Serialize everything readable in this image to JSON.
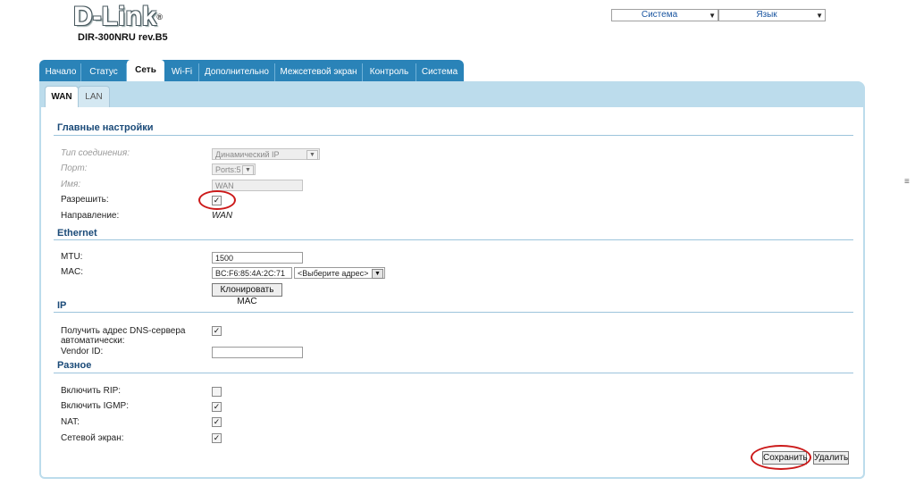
{
  "logo": {
    "brand": "D-Link",
    "reg": "®",
    "model": "DIR-300NRU rev.B5"
  },
  "top_selects": {
    "system": "Система",
    "language": "Язык"
  },
  "tabs": [
    {
      "label": "Начало"
    },
    {
      "label": "Статус"
    },
    {
      "label": "Сеть"
    },
    {
      "label": "Wi-Fi"
    },
    {
      "label": "Дополнительно"
    },
    {
      "label": "Межсетевой экран"
    },
    {
      "label": "Контроль"
    },
    {
      "label": "Система"
    }
  ],
  "active_tab": "Сеть",
  "subtabs": [
    {
      "label": "WAN"
    },
    {
      "label": "LAN"
    }
  ],
  "active_subtab": "WAN",
  "main_settings": {
    "title": "Главные настройки",
    "connection_type_label": "Тип соединения:",
    "connection_type_value": "Динамический IP",
    "port_label": "Порт:",
    "port_value": "Ports:5",
    "name_label": "Имя:",
    "name_value": "WAN",
    "enable_label": "Разрешить:",
    "enable_checked": true,
    "direction_label": "Направление:",
    "direction_value": "WAN"
  },
  "ethernet": {
    "title": "Ethernet",
    "mtu_label": "MTU:",
    "mtu_value": "1500",
    "mac_label": "MAC:",
    "mac_value": "BC:F6:85:4A:2C:71",
    "mac_select": "<Выберите адрес>",
    "clone_button": "Клонировать MAC"
  },
  "ip": {
    "title": "IP",
    "dns_label_line1": "Получить адрес DNS-сервера",
    "dns_label_line2": "автоматически:",
    "dns_checked": true,
    "vendor_label": "Vendor ID:",
    "vendor_value": ""
  },
  "misc": {
    "title": "Разное",
    "rip_label": "Включить RIP:",
    "rip_checked": false,
    "igmp_label": "Включить IGMP:",
    "igmp_checked": true,
    "nat_label": "NAT:",
    "nat_checked": true,
    "firewall_label": "Сетевой экран:",
    "firewall_checked": true
  },
  "actions": {
    "save": "Сохранить",
    "delete": "Удалить"
  },
  "icons": {
    "dropdown": "chevron-down-icon",
    "checkbox": "checkmark-icon",
    "scroll": "scroll-grip-icon"
  },
  "colors": {
    "tab_bar": "#2a83b8",
    "panel_header": "#bcdcec",
    "section_title": "#1a4a78",
    "highlight_circle": "#cc1a1a"
  }
}
